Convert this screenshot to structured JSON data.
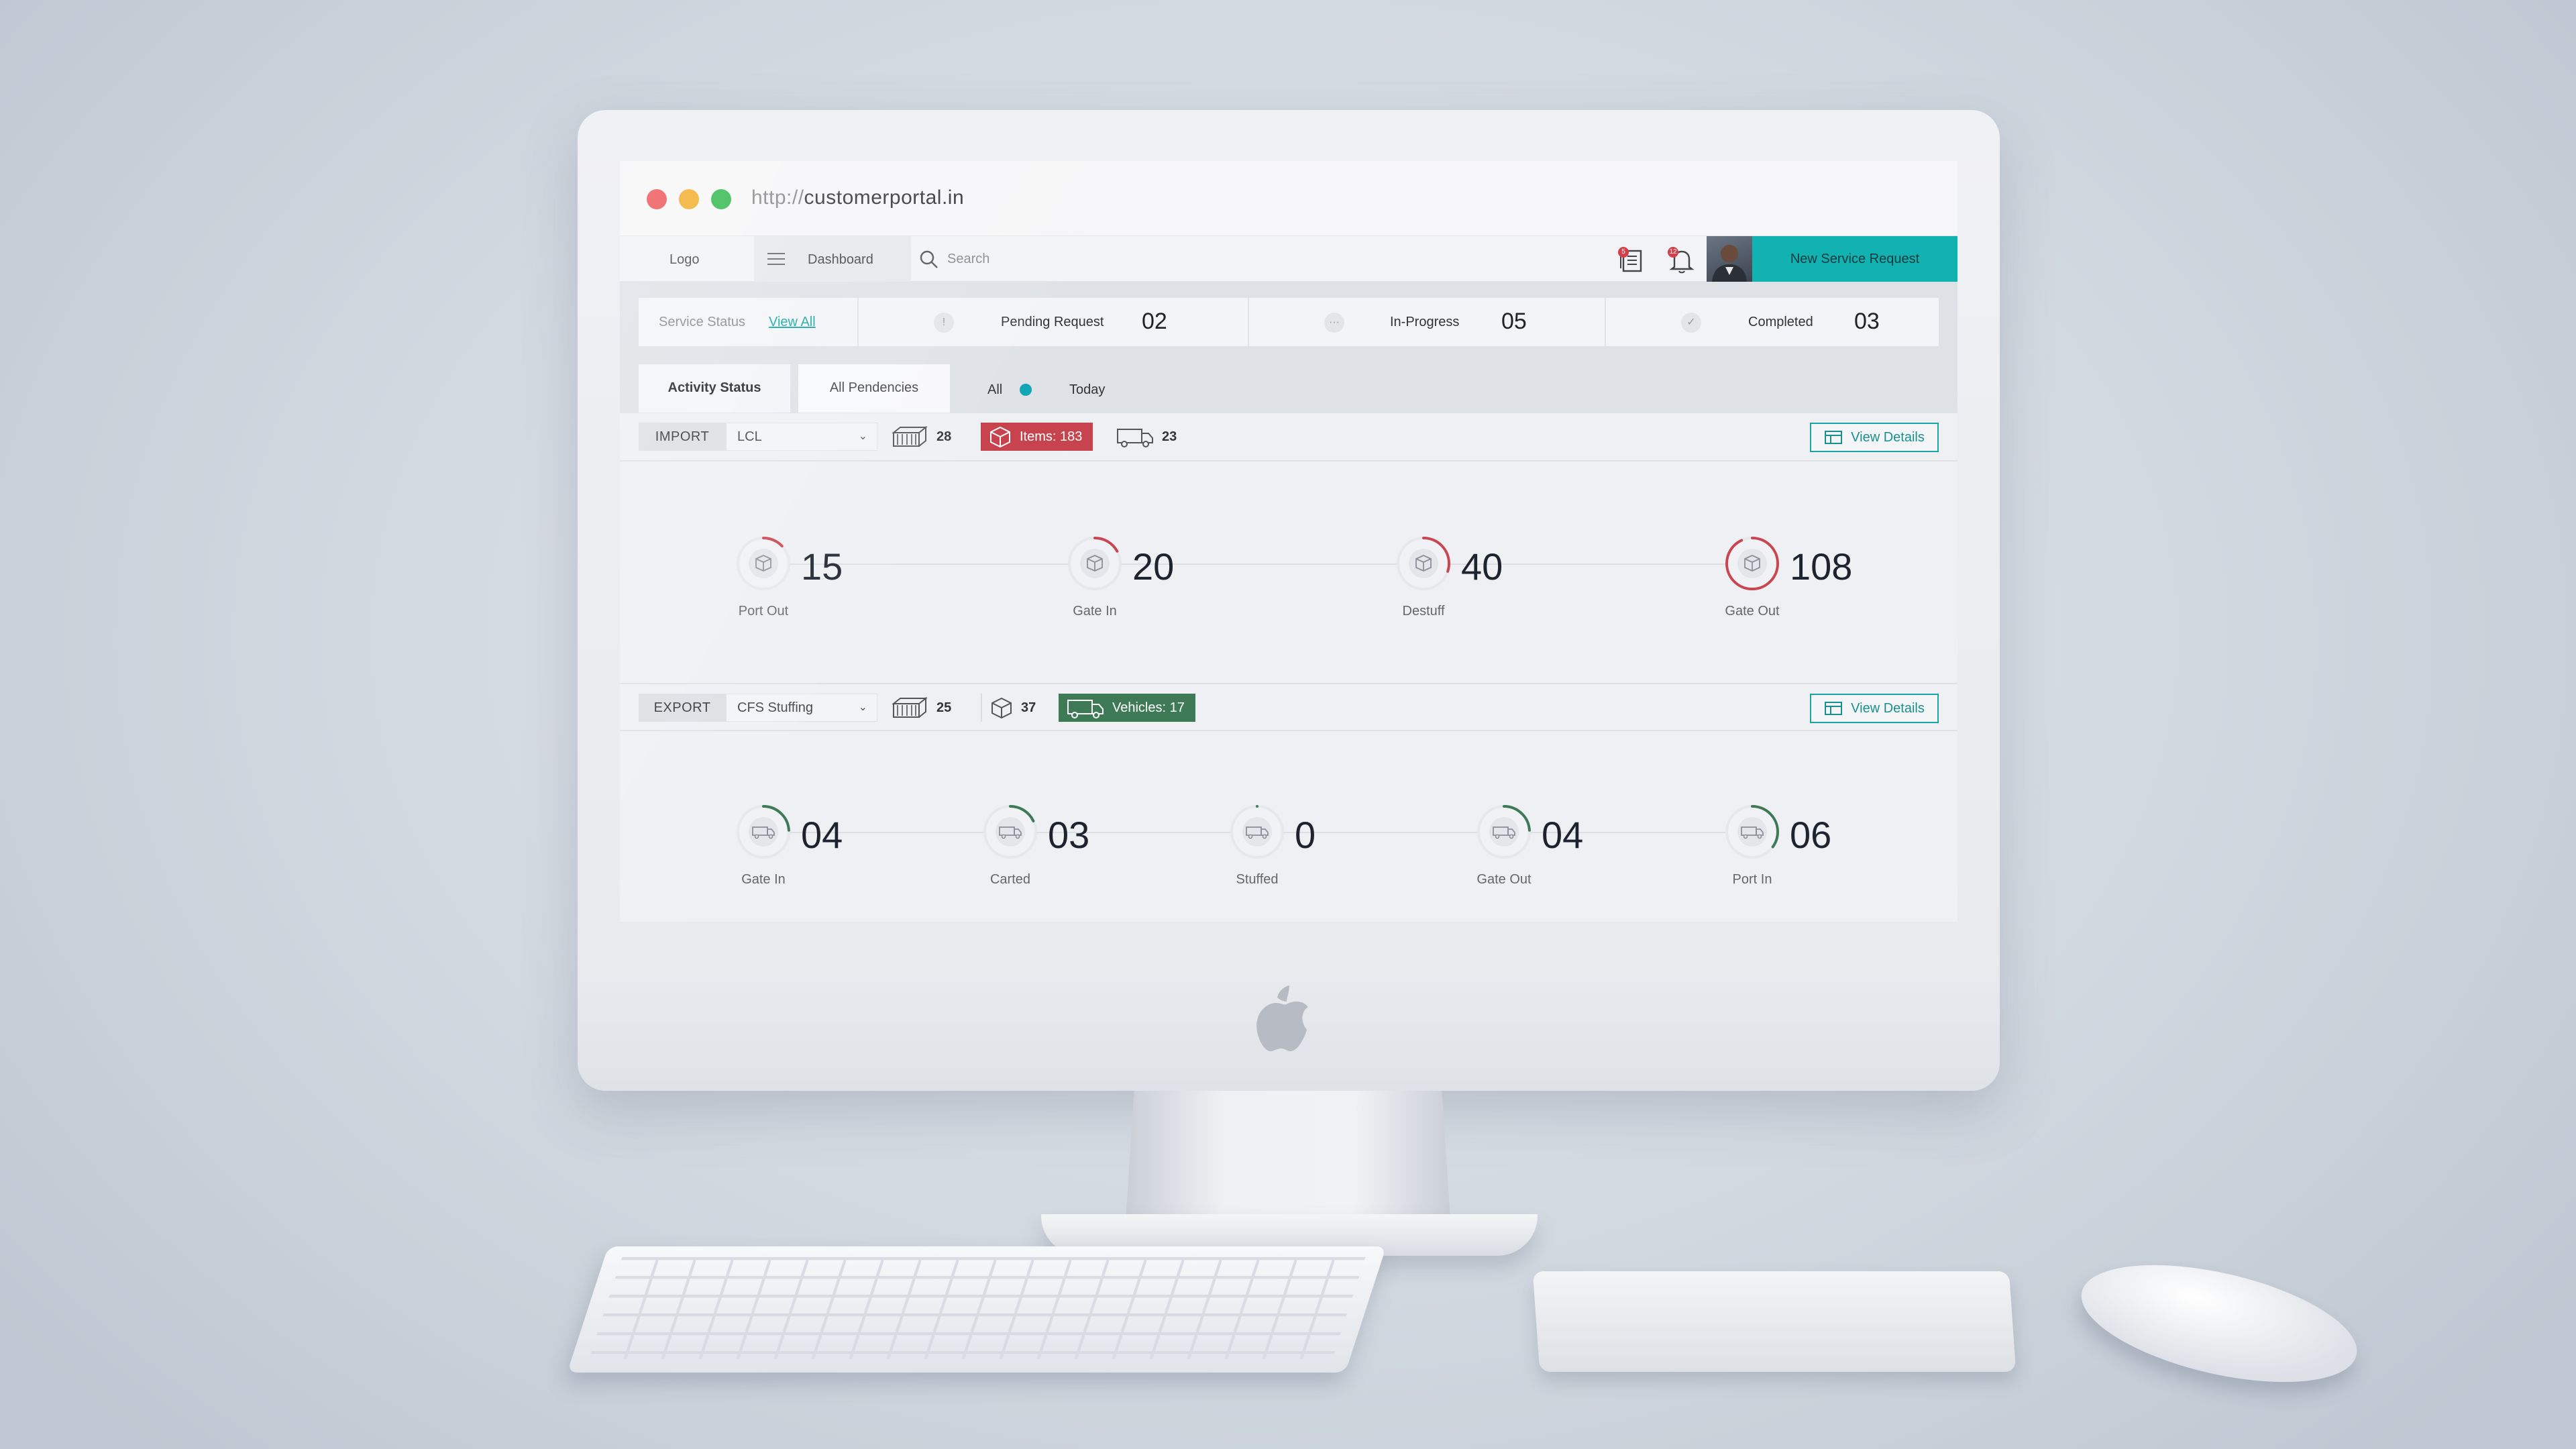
{
  "browser": {
    "url_scheme": "http://",
    "url_host": "customerportal.in"
  },
  "appbar": {
    "logo": "Logo",
    "nav_label": "Dashboard",
    "search_placeholder": "Search",
    "doc_badge": "5",
    "bell_badge": "12",
    "cta_label": "New Service Request",
    "accent": "#12b2b2"
  },
  "service_status": {
    "label": "Service Status",
    "view_all": "View All",
    "items": [
      {
        "name": "Pending Request",
        "value": "02",
        "icon": "!"
      },
      {
        "name": "In-Progress",
        "value": "05",
        "icon": "···"
      },
      {
        "name": "Completed",
        "value": "03",
        "icon": "✓"
      }
    ]
  },
  "tabs": [
    {
      "label": "Activity Status",
      "active": true
    },
    {
      "label": "All Pendencies",
      "active": false
    }
  ],
  "toggle": {
    "left": "All",
    "right": "Today"
  },
  "import": {
    "mode": "IMPORT",
    "select": "LCL",
    "containers": "28",
    "items_label": "Items: 183",
    "vehicles": "23",
    "view_details": "View Details",
    "steps": [
      {
        "value": "15",
        "label": "Port Out",
        "progress": 0.13,
        "icon": "box-icon"
      },
      {
        "value": "20",
        "label": "Gate In",
        "progress": 0.17,
        "icon": "box-icon"
      },
      {
        "value": "40",
        "label": "Destuff",
        "progress": 0.3,
        "icon": "box-icon"
      },
      {
        "value": "108",
        "label": "Gate Out",
        "progress": 0.93,
        "icon": "box-icon"
      }
    ],
    "color": "#c94650"
  },
  "export": {
    "mode": "EXPORT",
    "select": "CFS Stuffing",
    "containers": "25",
    "items": "37",
    "vehicles_label": "Vehicles: 17",
    "view_details": "View Details",
    "steps": [
      {
        "value": "04",
        "label": "Gate In",
        "progress": 0.24,
        "icon": "truck-icon"
      },
      {
        "value": "03",
        "label": "Carted",
        "progress": 0.18,
        "icon": "truck-icon"
      },
      {
        "value": "0",
        "label": "Stuffed",
        "progress": 0,
        "icon": "truck-icon"
      },
      {
        "value": "04",
        "label": "Gate Out",
        "progress": 0.24,
        "icon": "truck-icon"
      },
      {
        "value": "06",
        "label": "Port In",
        "progress": 0.35,
        "icon": "truck-icon"
      }
    ],
    "color": "#3f7a57"
  }
}
